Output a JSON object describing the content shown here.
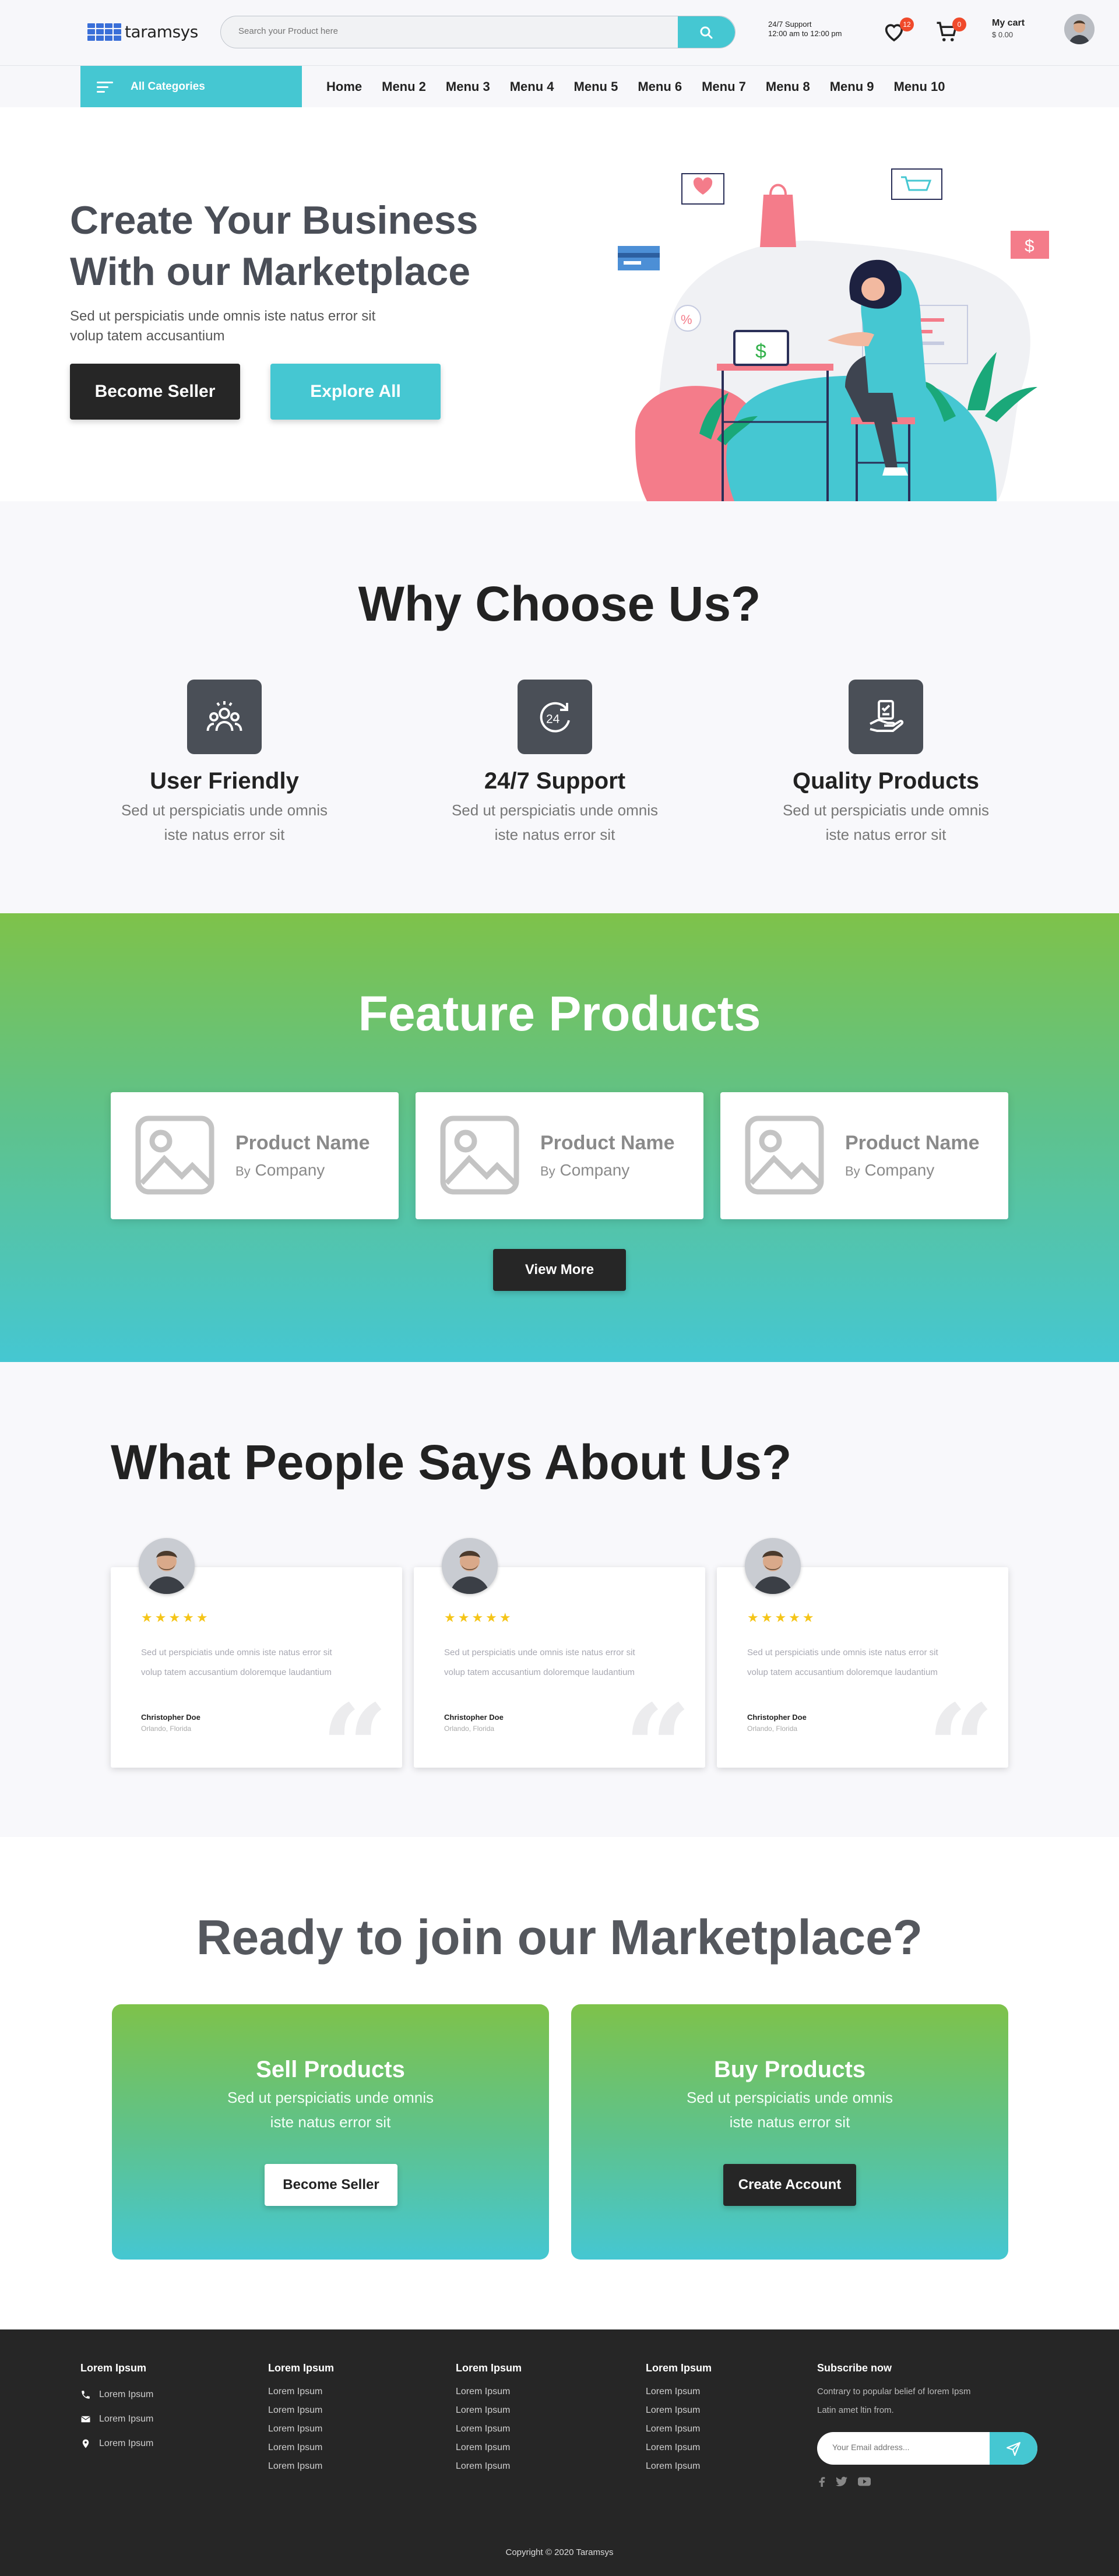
{
  "header": {
    "logo_text": "taramsys",
    "search_placeholder": "Search your Product here",
    "support_line1": "24/7 Support",
    "support_line2": "12:00 am to 12:00 pm",
    "wishlist_count": "12",
    "cart_count": "0",
    "cart_label": "My cart",
    "cart_amount": "$ 0.00"
  },
  "nav": {
    "all_categories": "All Categories",
    "menus": [
      "Home",
      "Menu 2",
      "Menu 3",
      "Menu 4",
      "Menu 5",
      "Menu 6",
      "Menu 7",
      "Menu 8",
      "Menu 9",
      "Menu 10"
    ]
  },
  "hero": {
    "title_line1": "Create Your Business",
    "title_line2": "With our Marketplace",
    "subtitle_line1": "Sed ut perspiciatis unde omnis iste natus error sit",
    "subtitle_line2": "volup tatem accusantium",
    "primary_btn": "Become Seller",
    "secondary_btn": "Explore All",
    "illustration_price_tag": "$"
  },
  "why": {
    "title": "Why Choose Us?",
    "features": [
      {
        "icon": "users-icon",
        "title": "User Friendly",
        "line1": "Sed ut perspiciatis unde omnis",
        "line2": "iste natus error sit"
      },
      {
        "icon": "24h-support-icon",
        "title": "24/7 Support",
        "line1": "Sed ut perspiciatis unde omnis",
        "line2": "iste natus error sit"
      },
      {
        "icon": "quality-hand-icon",
        "title": "Quality Products",
        "line1": "Sed ut perspiciatis unde omnis",
        "line2": "iste natus error sit"
      }
    ]
  },
  "featured": {
    "title": "Feature Products",
    "products": [
      {
        "name": "Product Name",
        "by": "By",
        "company": "Company"
      },
      {
        "name": "Product Name",
        "by": "By",
        "company": "Company"
      },
      {
        "name": "Product Name",
        "by": "By",
        "company": "Company"
      }
    ],
    "view_more": "View More"
  },
  "testimonials": {
    "title": "What People Says About Us?",
    "items": [
      {
        "stars": "★★★★★",
        "line1": "Sed ut perspiciatis unde omnis iste natus error sit",
        "line2": "volup tatem accusantium doloremque laudantium",
        "name": "Christopher Doe",
        "location": "Orlando, Florida"
      },
      {
        "stars": "★★★★★",
        "line1": "Sed ut perspiciatis unde omnis iste natus error sit",
        "line2": "volup tatem accusantium doloremque laudantium",
        "name": "Christopher Doe",
        "location": "Orlando, Florida"
      },
      {
        "stars": "★★★★★",
        "line1": "Sed ut perspiciatis unde omnis iste natus error sit",
        "line2": "volup tatem accusantium doloremque laudantium",
        "name": "Christopher Doe",
        "location": "Orlando, Florida"
      }
    ]
  },
  "ready": {
    "title": "Ready to join our Marketplace?",
    "sell": {
      "title": "Sell Products",
      "line1": "Sed ut perspiciatis unde omnis",
      "line2": "iste natus error sit",
      "button": "Become Seller"
    },
    "buy": {
      "title": "Buy Products",
      "line1": "Sed ut perspiciatis unde omnis",
      "line2": "iste natus error sit",
      "button": "Create Account"
    }
  },
  "footer": {
    "contact": {
      "title": "Lorem Ipsum",
      "items": [
        "Lorem Ipsum",
        "Lorem Ipsum",
        "Lorem Ipsum"
      ]
    },
    "columns": [
      {
        "title": "Lorem Ipsum",
        "items": [
          "Lorem Ipsum",
          "Lorem Ipsum",
          "Lorem Ipsum",
          "Lorem Ipsum",
          "Lorem Ipsum"
        ]
      },
      {
        "title": "Lorem Ipsum",
        "items": [
          "Lorem Ipsum",
          "Lorem Ipsum",
          "Lorem Ipsum",
          "Lorem Ipsum",
          "Lorem Ipsum"
        ]
      },
      {
        "title": "Lorem Ipsum",
        "items": [
          "Lorem Ipsum",
          "Lorem Ipsum",
          "Lorem Ipsum",
          "Lorem Ipsum",
          "Lorem Ipsum"
        ]
      }
    ],
    "subscribe": {
      "title": "Subscribe now",
      "line1": "Contrary to popular belief of lorem Ipsm",
      "line2": "Latin amet ltin from.",
      "placeholder": "Your Email address..."
    },
    "copyright": "Copyright © 2020 Taramsys"
  },
  "colors": {
    "accent": "#45c7d2",
    "green": "#7ec24a",
    "dark": "#262626",
    "badge": "#f04a2b"
  }
}
